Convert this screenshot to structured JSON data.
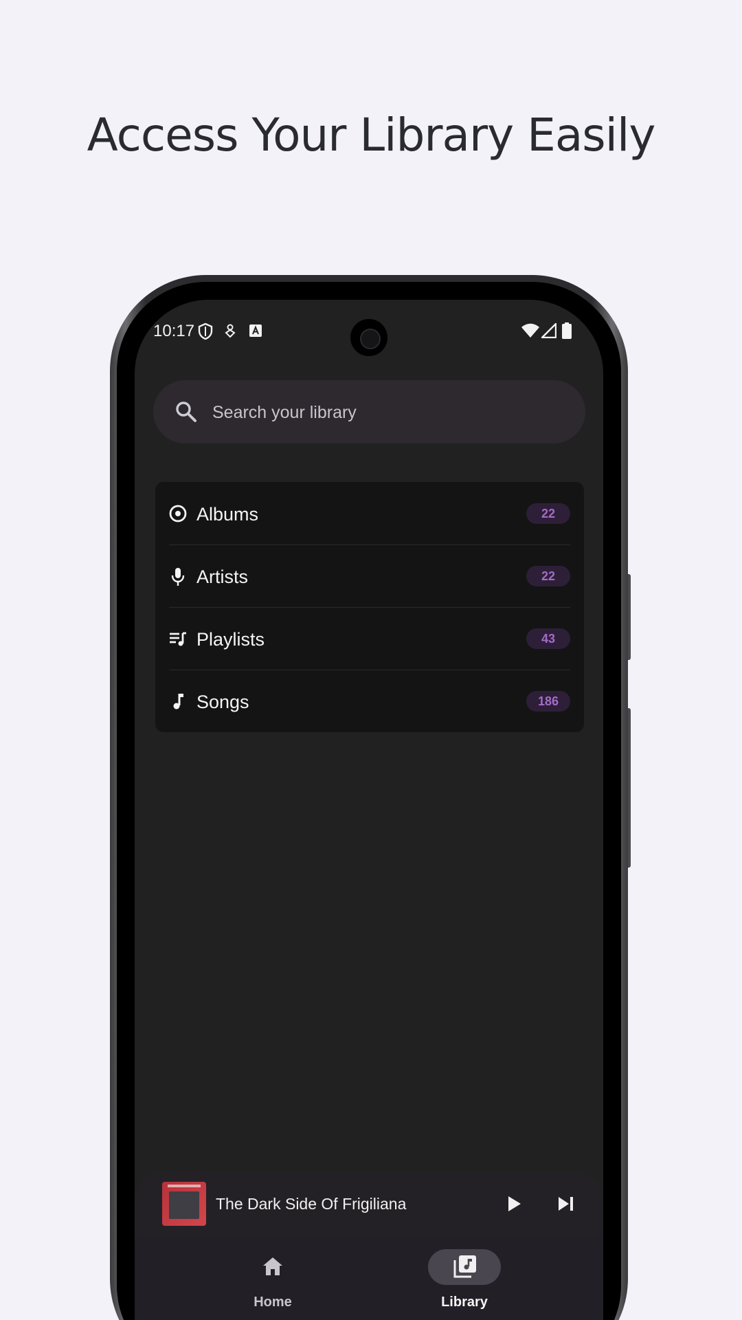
{
  "headline": "Access Your Library Easily",
  "status_bar": {
    "time": "10:17",
    "left_icons": [
      "shield-icon",
      "vpn-key-icon",
      "keyboard-a-icon"
    ],
    "right_icons": [
      "wifi-icon",
      "signal-icon",
      "battery-icon"
    ]
  },
  "search": {
    "placeholder": "Search your library"
  },
  "library_list": {
    "items": [
      {
        "label": "Albums",
        "count": "22",
        "icon": "album-icon"
      },
      {
        "label": "Artists",
        "count": "22",
        "icon": "microphone-icon"
      },
      {
        "label": "Playlists",
        "count": "43",
        "icon": "playlist-icon"
      },
      {
        "label": "Songs",
        "count": "186",
        "icon": "music-note-icon"
      }
    ]
  },
  "mini_player": {
    "title": "The Dark Side Of Frigiliana",
    "controls": [
      "play-icon",
      "skip-next-icon"
    ]
  },
  "bottom_nav": {
    "items": [
      {
        "label": "Home",
        "icon": "home-icon",
        "active": false
      },
      {
        "label": "Library",
        "icon": "library-music-icon",
        "active": true
      }
    ]
  },
  "colors": {
    "page_bg": "#f3f2f8",
    "screen_bg": "#212121",
    "badge_bg": "#2e1f38",
    "badge_text": "#a46bc8",
    "active_nav_pill": "#4a4650"
  }
}
